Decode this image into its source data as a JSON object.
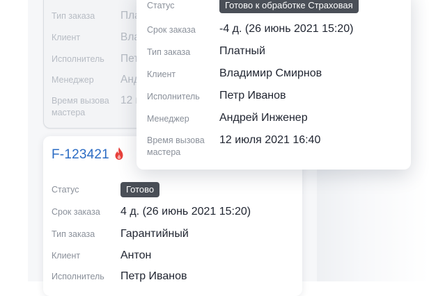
{
  "back_card": {
    "fields": [
      {
        "label": "Тип заказа",
        "value": "Пла"
      },
      {
        "label": "Клиент",
        "value": "Вла"
      },
      {
        "label": "Исполнитель",
        "value": "Пет"
      },
      {
        "label": "Менеджер",
        "value": "Анд"
      },
      {
        "label": "Время вызова мастера",
        "value": "12 и"
      }
    ]
  },
  "popup": {
    "status_label": "Статус",
    "status_badge": "Готово к обработке Страховая",
    "fields": [
      {
        "label": "Срок заказа",
        "value": "-4 д. (26 июнь 2021 15:20)"
      },
      {
        "label": "Тип заказа",
        "value": "Платный"
      },
      {
        "label": "Клиент",
        "value": "Владимир Смирнов"
      },
      {
        "label": "Исполнитель",
        "value": "Петр Иванов"
      },
      {
        "label": "Менеджер",
        "value": "Андрей Инженер"
      },
      {
        "label": "Время вызова мастера",
        "value": "12 июля 2021  16:40"
      }
    ]
  },
  "bottom_card": {
    "order_id": "F-123421",
    "status_label": "Статус",
    "status_badge": "Готово",
    "fields": [
      {
        "label": "Срок заказа",
        "value": "4 д. (26 июнь 2021 15:20)"
      },
      {
        "label": "Тип заказа",
        "value": "Гарантийный"
      },
      {
        "label": "Клиент",
        "value": "Антон"
      },
      {
        "label": "Исполнитель",
        "value": "Петр Иванов"
      }
    ]
  },
  "colors": {
    "order_id": "#2b6cc4",
    "badge": "#4a4f57",
    "fire": "#e8413c"
  },
  "icons": {
    "urgent": "fire-icon"
  }
}
